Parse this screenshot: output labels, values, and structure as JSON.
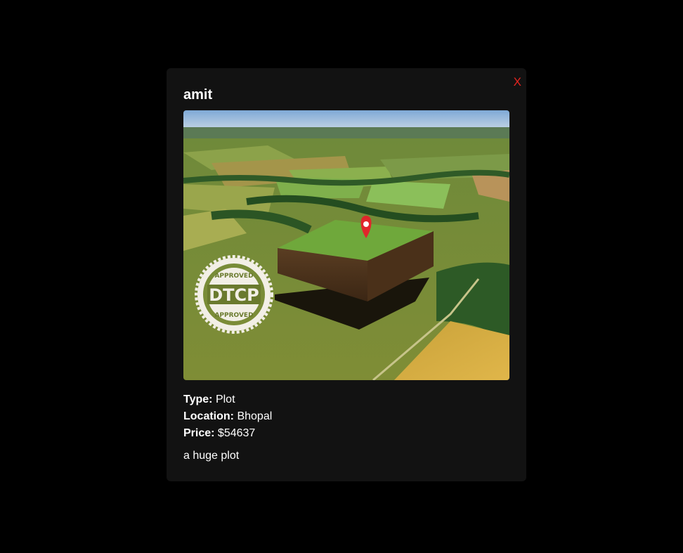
{
  "modal": {
    "title": "amit",
    "close_label": "X",
    "close_color": "#e3241f",
    "background": "#121212"
  },
  "listing": {
    "type_label": "Type:",
    "type_value": "Plot",
    "location_label": "Location:",
    "location_value": "Bhopal",
    "price_label": "Price:",
    "price_value": "$54637",
    "description": "a huge plot"
  },
  "image": {
    "subject": "aerial farmland with raised plot and map pin",
    "stamp_top": "APPROVED",
    "stamp_center": "DTCP",
    "stamp_bottom": "APPROVED"
  }
}
